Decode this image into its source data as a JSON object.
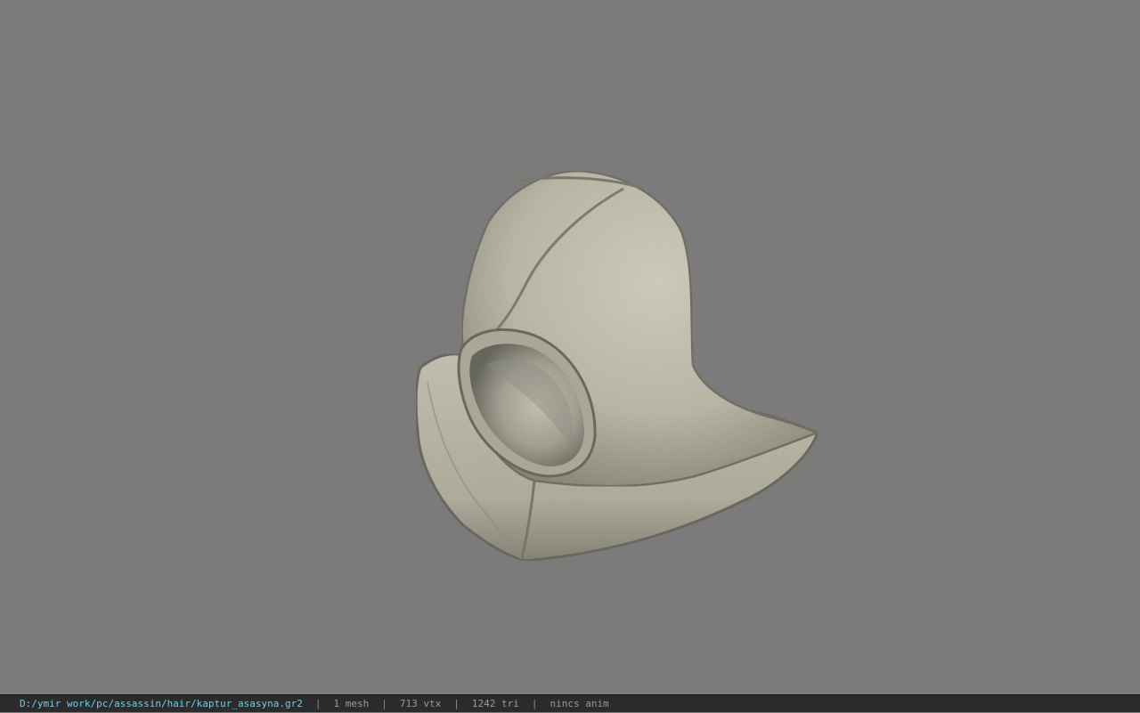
{
  "viewer": {
    "background_color": "#7b7b7b",
    "model_name": "hood-model"
  },
  "statusbar": {
    "path": "D:/ymir work/pc/assassin/hair/kaptur_asasyna.gr2",
    "separator": "|",
    "mesh_count": "1 mesh",
    "vertex_count": "713 vtx",
    "triangle_count": "1242 tri",
    "anim": "nincs anim",
    "path_color": "#6fcfe0",
    "text_color": "#9a9a9a"
  }
}
